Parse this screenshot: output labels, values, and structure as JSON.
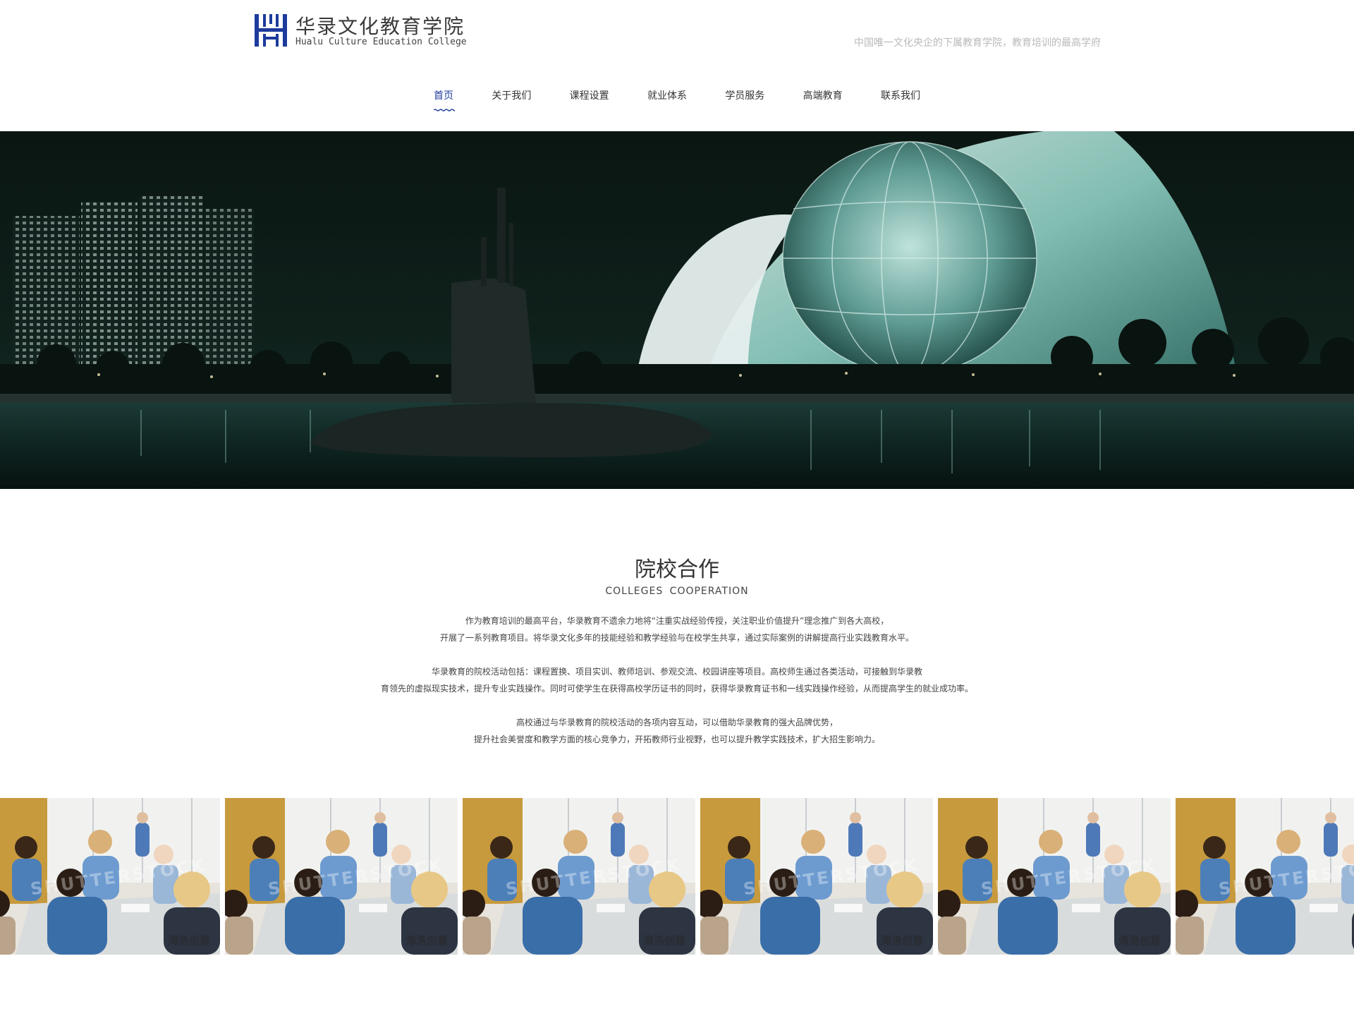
{
  "header": {
    "logo_cn": "华录文化教育学院",
    "logo_en": "Hualu Culture Education College",
    "slogan": "中国唯一文化央企的下属教育学院，教育培训的最高学府"
  },
  "nav": {
    "items": [
      {
        "label": "首页"
      },
      {
        "label": "关于我们"
      },
      {
        "label": "课程设置"
      },
      {
        "label": "就业体系"
      },
      {
        "label": "学员服务"
      },
      {
        "label": "高端教育"
      },
      {
        "label": "联系我们"
      }
    ]
  },
  "colors": {
    "brand_blue": "#1d3b9c",
    "slogan_gray": "#b9b9b9"
  },
  "section": {
    "title": "院校合作",
    "subtitle": "COLLEGES  COOPERATION",
    "paragraphs": [
      {
        "lines": [
          "作为教育培训的最高平台，华录教育不遗余力地将“注重实战经验传授，关注职业价值提升”理念推广到各大高校，",
          "开展了一系列教育项目。将华录文化多年的技能经验和教学经验与在校学生共享，通过实际案例的讲解提高行业实践教育水平。"
        ]
      },
      {
        "lines": [
          "华录教育的院校活动包括：课程置换、项目实训、教师培训、参观交流、校园讲座等项目。高校师生通过各类活动，可接触到华录教",
          "育领先的虚拟现实技术，提升专业实践操作。同时可使学生在获得高校学历证书的同时，获得华录教育证书和一线实践操作经验，从而提高学生的就业成功率。"
        ]
      },
      {
        "lines": [
          "高校通过与华录教育的院校活动的各项内容互动，可以借助华录教育的强大品牌优势，",
          "提升社会美誉度和教学方面的核心竞争力，开拓教师行业视野，也可以提升教学实践技术，扩大招生影响力。"
        ]
      }
    ]
  },
  "gallery": {
    "watermark_main": "SHUTTERSTOCK",
    "watermark_corner": "海洛创意",
    "items": [
      {
        "name": "gallery-photo-1"
      },
      {
        "name": "gallery-photo-2"
      },
      {
        "name": "gallery-photo-3"
      },
      {
        "name": "gallery-photo-4"
      },
      {
        "name": "gallery-photo-5"
      },
      {
        "name": "gallery-photo-6"
      }
    ]
  }
}
